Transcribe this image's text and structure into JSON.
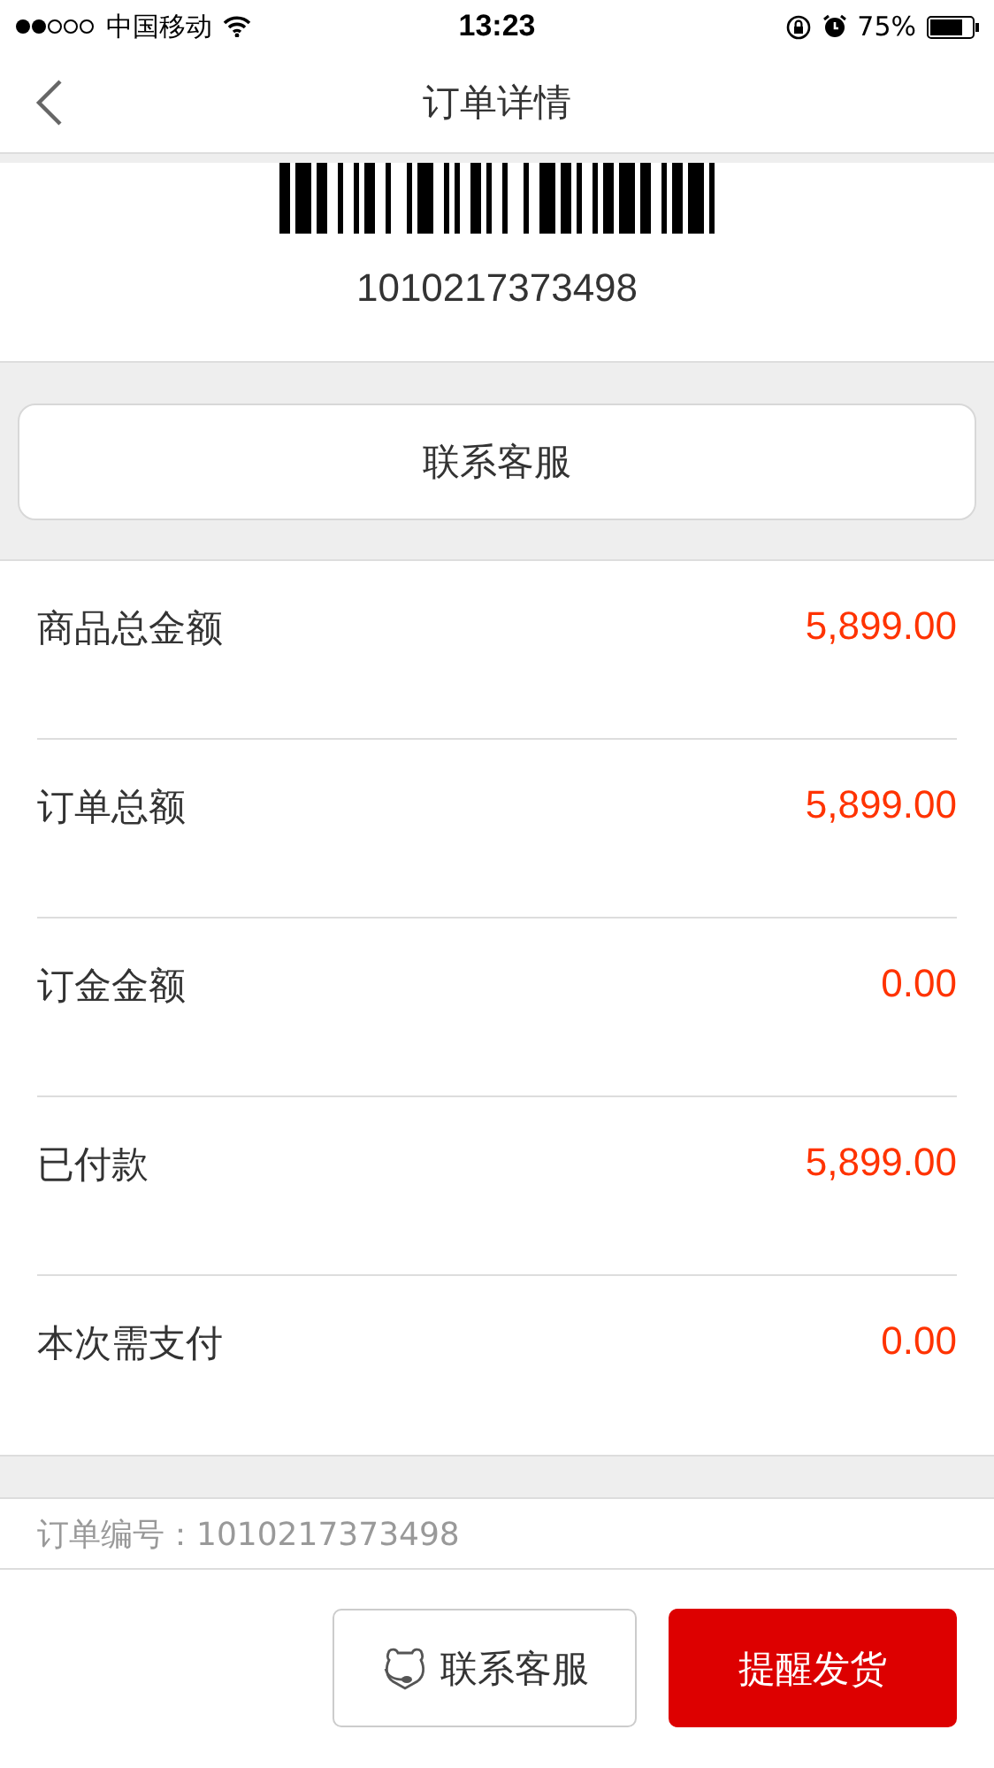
{
  "status_bar": {
    "carrier": "中国移动",
    "time": "13:23",
    "battery": "75%"
  },
  "nav": {
    "title": "订单详情"
  },
  "barcode": {
    "number": "1010217373498"
  },
  "contact_button": "联系客服",
  "amounts": [
    {
      "label": "商品总金额",
      "value": "5,899.00"
    },
    {
      "label": "订单总额",
      "value": "5,899.00"
    },
    {
      "label": "订金金额",
      "value": "0.00"
    },
    {
      "label": "已付款",
      "value": "5,899.00"
    },
    {
      "label": "本次需支付",
      "value": "0.00"
    }
  ],
  "order_number": {
    "label": "订单编号：",
    "value": "1010217373498"
  },
  "bottom_bar": {
    "service_button": "联系客服",
    "remind_button": "提醒发货"
  }
}
